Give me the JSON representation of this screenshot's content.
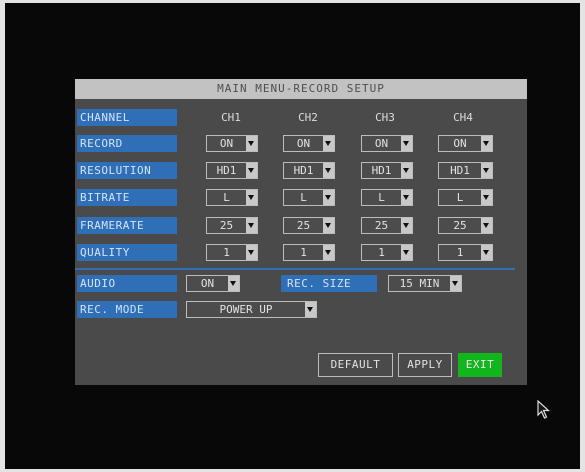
{
  "title": "MAIN MENU-RECORD SETUP",
  "labels": {
    "channel": "CHANNEL",
    "record": "RECORD",
    "resolution": "RESOLUTION",
    "bitrate": "BITRATE",
    "framerate": "FRAMERATE",
    "quality": "QUALITY",
    "audio": "AUDIO",
    "rec_size": "REC. SIZE",
    "rec_mode": "REC. MODE"
  },
  "channels": [
    "CH1",
    "CH2",
    "CH3",
    "CH4"
  ],
  "values": {
    "record": [
      "ON",
      "ON",
      "ON",
      "ON"
    ],
    "resolution": [
      "HD1",
      "HD1",
      "HD1",
      "HD1"
    ],
    "bitrate": [
      "L",
      "L",
      "L",
      "L"
    ],
    "framerate": [
      "25",
      "25",
      "25",
      "25"
    ],
    "quality": [
      "1",
      "1",
      "1",
      "1"
    ],
    "audio": "ON",
    "rec_size": "15 MIN",
    "rec_mode": "POWER UP"
  },
  "buttons": {
    "default": "DEFAULT",
    "apply": "APPLY",
    "exit": "EXIT"
  },
  "colors": {
    "label_bg": "#2f6fb8",
    "selected_button": "#12b51c",
    "title_bar": "#c2c2c2"
  }
}
